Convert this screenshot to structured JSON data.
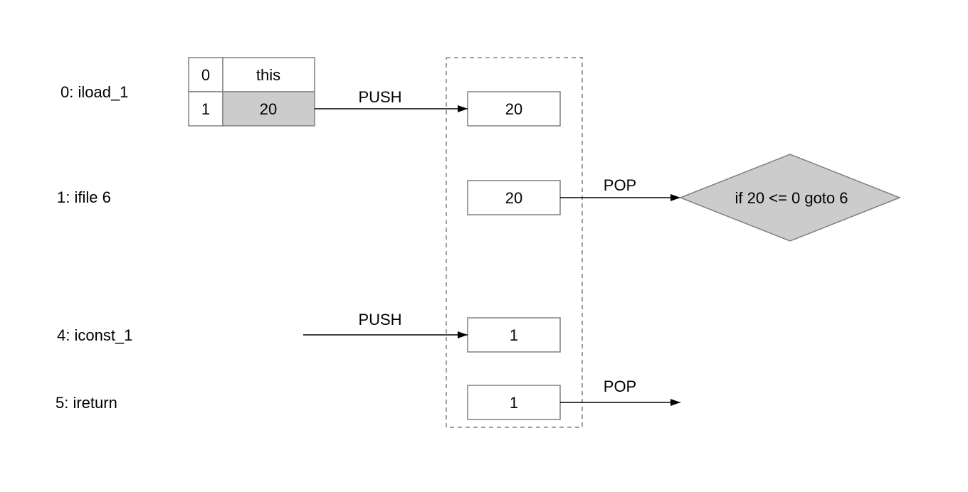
{
  "instructions": [
    {
      "label": "0: iload_1"
    },
    {
      "label": "1: ifile 6"
    },
    {
      "label": "4: iconst_1"
    },
    {
      "label": "5: ireturn"
    }
  ],
  "local_variable_table": {
    "rows": [
      {
        "index": "0",
        "value": "this",
        "highlighted": false
      },
      {
        "index": "1",
        "value": "20",
        "highlighted": true
      }
    ]
  },
  "operand_stack": {
    "slots": [
      {
        "value": "20"
      },
      {
        "value": "20"
      },
      {
        "value": "1"
      },
      {
        "value": "1"
      }
    ]
  },
  "edges": [
    {
      "label": "PUSH"
    },
    {
      "label": "POP"
    },
    {
      "label": "PUSH"
    },
    {
      "label": "POP"
    }
  ],
  "decision": {
    "text": "if 20 <= 0 goto 6"
  },
  "colors": {
    "highlight": "#cccccc",
    "border": "#808080"
  }
}
